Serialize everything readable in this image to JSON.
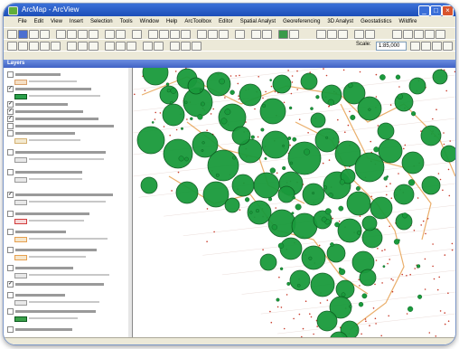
{
  "window": {
    "title": "ArcMap - ArcView"
  },
  "menu": [
    "File",
    "Edit",
    "View",
    "Insert",
    "Selection",
    "Tools",
    "Window",
    "Help",
    "ArcToolbox",
    "Editor",
    "Spatial Analyst",
    "Georeferencing",
    "3D Analyst",
    "Geostatistics",
    "Wildfire"
  ],
  "toolbar": {
    "scale_value": "1:85,000"
  },
  "toc": {
    "title": "Layers"
  },
  "colors": {
    "circle_green": "#1a9a3c",
    "circle_stroke": "#0b5a1e",
    "boundary": "#e6a050",
    "red_dot": "#c83a2a",
    "grid": "#d4b8b0"
  }
}
